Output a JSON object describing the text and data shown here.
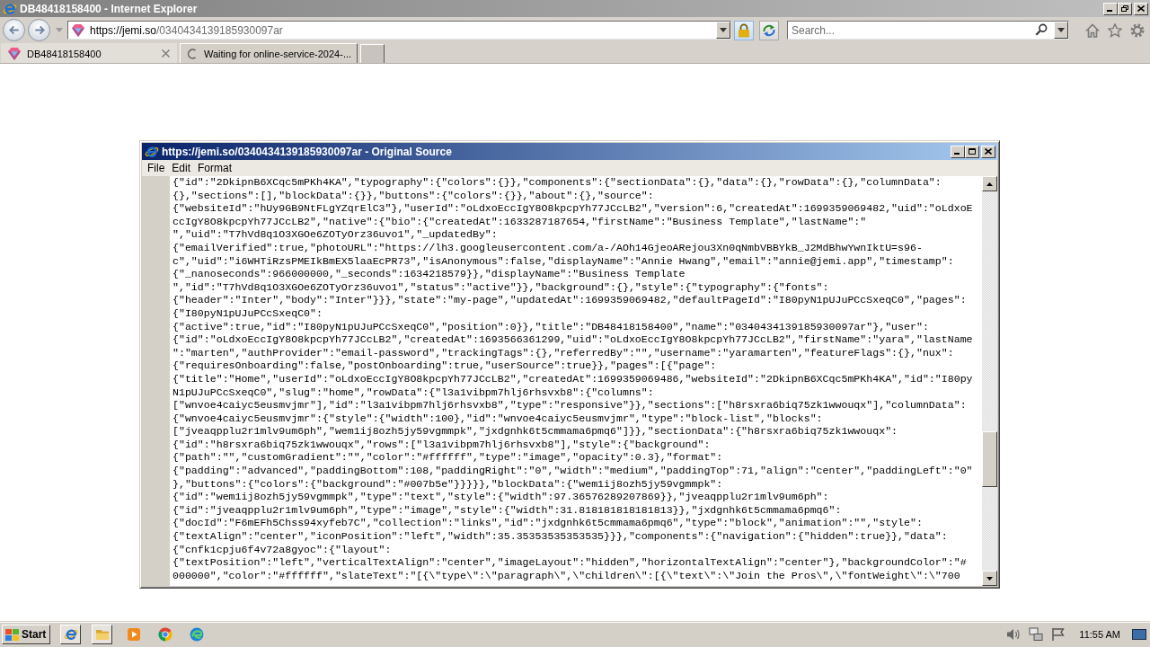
{
  "browser": {
    "title": "DB48418158400 - Internet Explorer",
    "active": false,
    "maximized": true,
    "address": {
      "host": "https://jemi.so",
      "path": "/0340434139185930097ar"
    },
    "search": {
      "placeholder": "Search..."
    },
    "tabs": [
      {
        "label": "DB48418158400",
        "kind": "page",
        "selected": true
      },
      {
        "label": "Waiting for online-service-2024-...",
        "kind": "loading",
        "selected": false
      }
    ]
  },
  "source_window": {
    "title": "https://jemi.so/0340434139185930097ar - Original Source",
    "active": true,
    "maximized": false,
    "menu": [
      "File",
      "Edit",
      "Format"
    ],
    "lines": [
      "{\"id\":\"2DkipnB6XCqc5mPKh4KA\",\"typography\":{\"colors\":{}},\"components\":{\"sectionData\":{},\"data\":{},\"rowData\":{},\"columnData\":",
      "{},\"sections\":[],\"blockData\":{}},\"buttons\":{\"colors\":{}},\"about\":{},\"source\":",
      "{\"websiteId\":\"hUy9GB9NtFLgYZqrElC3\"},\"userId\":\"oLdxoEccIgY8O8kpcpYh77JCcLB2\",\"version\":6,\"createdAt\":1699359069482,\"uid\":\"oLdxoE",
      "ccIgY8O8kpcpYh77JCcLB2\",\"native\":{\"bio\":{\"createdAt\":1633287187654,\"firstName\":\"Business Template\",\"lastName\":\"",
      "\",\"uid\":\"T7hVd8q1O3XGOe6ZOTyOrz36uvo1\",\"_updatedBy\":",
      "{\"emailVerified\":true,\"photoURL\":\"https://lh3.googleusercontent.com/a-/AOh14GjeoARejou3Xn0qNmbVBBYkB_J2MdBhwYwnIktU=s96-",
      "c\",\"uid\":\"i6WHTiRzsPMEIkBmEX5laaEcPR73\",\"isAnonymous\":false,\"displayName\":\"Annie Hwang\",\"email\":\"annie@jemi.app\",\"timestamp\":",
      "{\"_nanoseconds\":966000000,\"_seconds\":1634218579}},\"displayName\":\"Business Template",
      "\",\"id\":\"T7hVd8q1O3XGOe6ZOTyOrz36uvo1\",\"status\":\"active\"}},\"background\":{},\"style\":{\"typography\":{\"fonts\":",
      "{\"header\":\"Inter\",\"body\":\"Inter\"}}},\"state\":\"my-page\",\"updatedAt\":1699359069482,\"defaultPageId\":\"I80pyN1pUJuPCcSxeqC0\",\"pages\":",
      "{\"I80pyN1pUJuPCcSxeqC0\":",
      "{\"active\":true,\"id\":\"I80pyN1pUJuPCcSxeqC0\",\"position\":0}},\"title\":\"DB48418158400\",\"name\":\"0340434139185930097ar\"},\"user\":",
      "{\"id\":\"oLdxoEccIgY8O8kpcpYh77JCcLB2\",\"createdAt\":1693566361299,\"uid\":\"oLdxoEccIgY8O8kpcpYh77JCcLB2\",\"firstName\":\"yara\",\"lastName",
      "\":\"marten\",\"authProvider\":\"email-password\",\"trackingTags\":{},\"referredBy\":\"\",\"username\":\"yaramarten\",\"featureFlags\":{},\"nux\":",
      "{\"requiresOnboarding\":false,\"postOnboarding\":true,\"userSource\":true}},\"pages\":[{\"page\":",
      "{\"title\":\"Home\",\"userId\":\"oLdxoEccIgY8O8kpcpYh77JCcLB2\",\"createdAt\":1699359069486,\"websiteId\":\"2DkipnB6XCqc5mPKh4KA\",\"id\":\"I80py",
      "N1pUJuPCcSxeqC0\",\"slug\":\"home\",\"rowData\":{\"l3a1vibpm7hlj6rhsvxb8\":{\"columns\":",
      "[\"wnvoe4caiyc5eusmvjmr\"],\"id\":\"l3a1vibpm7hlj6rhsvxb8\",\"type\":\"responsive\"}},\"sections\":[\"h8rsxra6biq75zk1wwouqx\"],\"columnData\":",
      "{\"wnvoe4caiyc5eusmvjmr\":{\"style\":{\"width\":100},\"id\":\"wnvoe4caiyc5eusmvjmr\",\"type\":\"block-list\",\"blocks\":",
      "[\"jveaqpplu2r1mlv9um6ph\",\"wem1ij8ozh5jy59vgmmpk\",\"jxdgnhk6t5cmmama6pmq6\"]}},\"sectionData\":{\"h8rsxra6biq75zk1wwouqx\":",
      "{\"id\":\"h8rsxra6biq75zk1wwouqx\",\"rows\":[\"l3a1vibpm7hlj6rhsvxb8\"],\"style\":{\"background\":",
      "{\"path\":\"\",\"customGradient\":\"\",\"color\":\"#ffffff\",\"type\":\"image\",\"opacity\":0.3},\"format\":",
      "{\"padding\":\"advanced\",\"paddingBottom\":108,\"paddingRight\":\"0\",\"width\":\"medium\",\"paddingTop\":71,\"align\":\"center\",\"paddingLeft\":\"0\"",
      "},\"buttons\":{\"colors\":{\"background\":\"#007b5e\"}}}}},\"blockData\":{\"wem1ij8ozh5jy59vgmmpk\":",
      "{\"id\":\"wem1ij8ozh5jy59vgmmpk\",\"type\":\"text\",\"style\":{\"width\":97.36576289207869}},\"jveaqpplu2r1mlv9um6ph\":",
      "{\"id\":\"jveaqpplu2r1mlv9um6ph\",\"type\":\"image\",\"style\":{\"width\":31.818181818181813}},\"jxdgnhk6t5cmmama6pmq6\":",
      "{\"docId\":\"F6mEFh5Chss94xyfeb7C\",\"collection\":\"links\",\"id\":\"jxdgnhk6t5cmmama6pmq6\",\"type\":\"block\",\"animation\":\"\",\"style\":",
      "{\"textAlign\":\"center\",\"iconPosition\":\"left\",\"width\":35.35353535353535}}},\"components\":{\"navigation\":{\"hidden\":true}},\"data\":",
      "{\"cnfk1cpju6f4v72a8gyoc\":{\"layout\":",
      "{\"textPosition\":\"left\",\"verticalTextAlign\":\"center\",\"imageLayout\":\"hidden\",\"horizontalTextAlign\":\"center\"},\"backgroundColor\":\"#",
      "000000\",\"color\":\"#ffffff\",\"slateText\":\"[{\\\"type\\\":\\\"paragraph\\\",\\\"children\\\":[{\\\"text\\\":\\\"Join the Pros\\\",\\\"fontWeight\\\":\\\"700"
    ]
  },
  "taskbar": {
    "start": "Start",
    "apps": [
      {
        "kind": "ie",
        "active": true
      },
      {
        "kind": "folder",
        "active": true
      },
      {
        "kind": "player",
        "active": false
      },
      {
        "kind": "chrome",
        "active": false
      },
      {
        "kind": "edge",
        "active": false
      }
    ],
    "clock": "11:55 AM"
  }
}
